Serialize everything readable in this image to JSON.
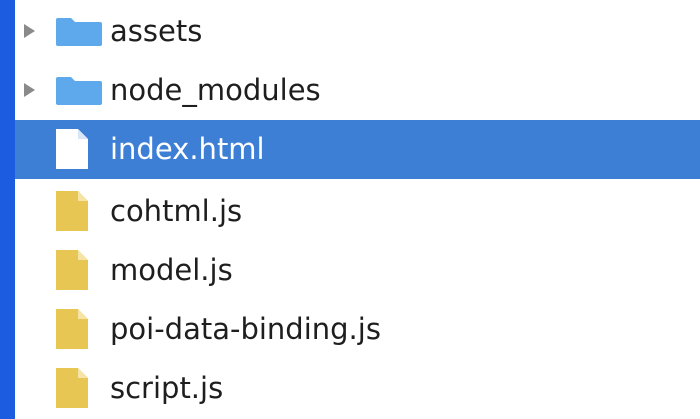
{
  "colors": {
    "accent_strip": "#1c5ce0",
    "selection": "#3e7fd6",
    "folder": "#5ea8ec",
    "js_file": "#e8c654",
    "text": "#1e1e1e",
    "selected_text": "#ffffff"
  },
  "tree": {
    "items": [
      {
        "label": "assets",
        "type": "folder",
        "icon": "folder-icon",
        "collapsed": true
      },
      {
        "label": "node_modules",
        "type": "folder",
        "icon": "folder-icon",
        "collapsed": true
      },
      {
        "label": "index.html",
        "type": "file",
        "icon": "file-html-icon",
        "selected": true
      },
      {
        "label": "cohtml.js",
        "type": "file",
        "icon": "file-js-icon"
      },
      {
        "label": "model.js",
        "type": "file",
        "icon": "file-js-icon"
      },
      {
        "label": "poi-data-binding.js",
        "type": "file",
        "icon": "file-js-icon"
      },
      {
        "label": "script.js",
        "type": "file",
        "icon": "file-js-icon"
      }
    ]
  }
}
